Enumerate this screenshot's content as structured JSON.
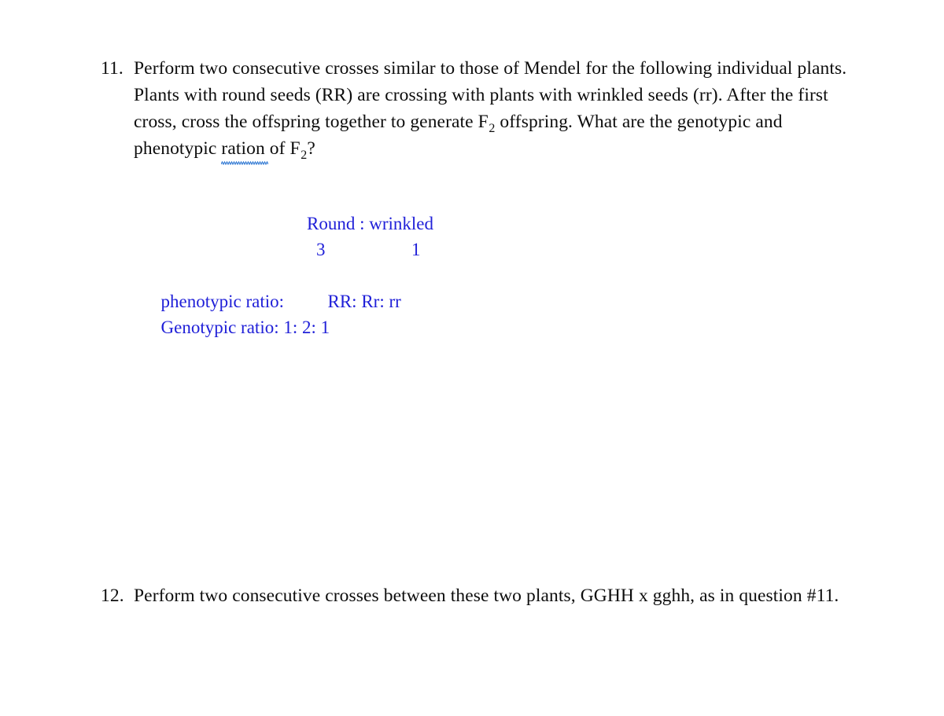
{
  "document": {
    "background_color": "#ffffff",
    "text_color": "#0d0d0d",
    "annotation_color": "#2020d8",
    "spellcheck_underline_color": "#3a7fd5"
  },
  "questions": [
    {
      "number": "11.",
      "text_part_1": "Perform two consecutive crosses similar to those of Mendel for the following individual plants. Plants with round seeds (RR) are crossing with plants with wrinkled seeds (rr). After the first cross, cross the offspring together to generate F",
      "subscript_1": "2",
      "text_part_2": " offspring. What are the genotypic and phenotypic ",
      "misspelled_word": "ration",
      "text_part_3": " of F",
      "subscript_2": "2",
      "text_part_4": "?"
    },
    {
      "number": "12.",
      "text": "Perform two consecutive crosses between these two plants, GGHH x gghh, as in question #11."
    }
  ],
  "answer": {
    "phenotype_header": "Round : wrinkled",
    "phenotype_value_left": "3",
    "phenotype_value_right": "1",
    "phenotypic_label": "phenotypic ratio:",
    "phenotypic_value": "RR: Rr: rr",
    "genotypic_line": "Genotypic ratio: 1: 2: 1"
  }
}
